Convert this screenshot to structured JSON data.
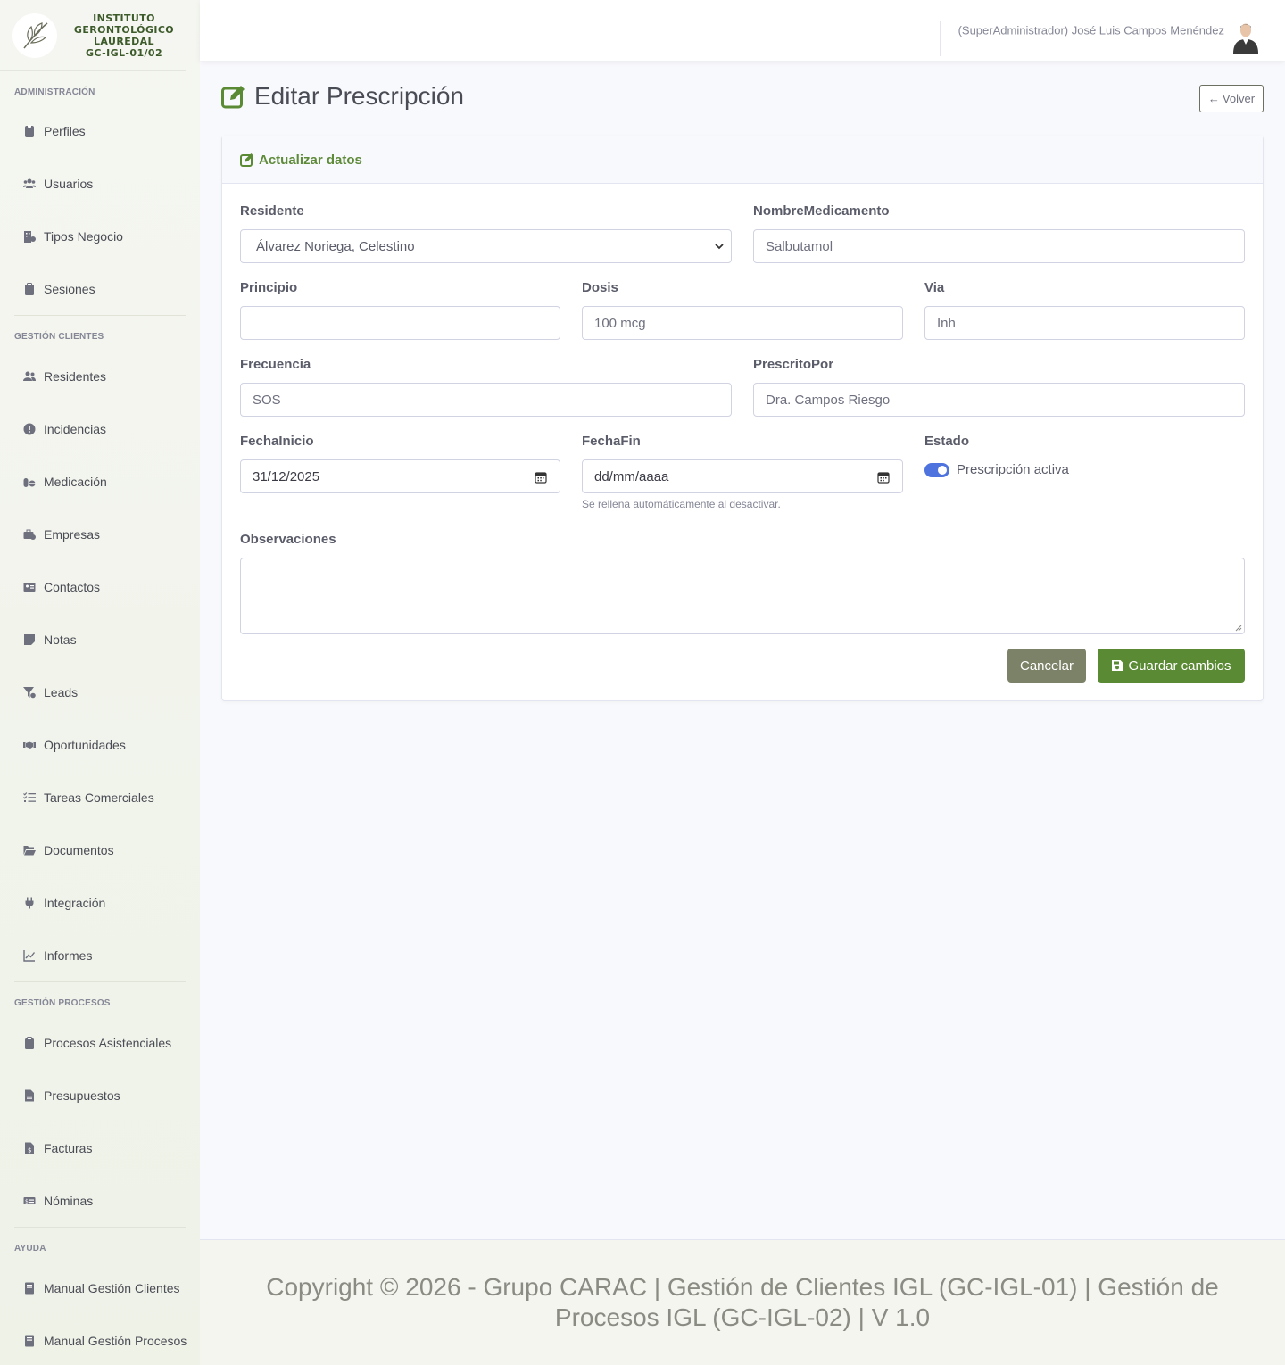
{
  "brand": {
    "line1": "INSTITUTO",
    "line2": "GERONTOLÓGICO",
    "line3": "LAUREDAL",
    "code": "GC-IGL-01/02"
  },
  "sidebar": {
    "sections": [
      {
        "heading": "ADMINISTRACIÓN",
        "items": [
          {
            "label": "Perfiles",
            "icon": "id-badge-icon"
          },
          {
            "label": "Usuarios",
            "icon": "users-icon"
          },
          {
            "label": "Tipos Negocio",
            "icon": "building-icon"
          },
          {
            "label": "Sesiones",
            "icon": "clipboard-icon"
          }
        ]
      },
      {
        "heading": "GESTIÓN CLIENTES",
        "items": [
          {
            "label": "Residentes",
            "icon": "user-friends-icon"
          },
          {
            "label": "Incidencias",
            "icon": "exclamation-circle-icon"
          },
          {
            "label": "Medicación",
            "icon": "pills-icon"
          },
          {
            "label": "Empresas",
            "icon": "briefcase-icon"
          },
          {
            "label": "Contactos",
            "icon": "address-card-icon"
          },
          {
            "label": "Notas",
            "icon": "sticky-note-icon"
          },
          {
            "label": "Leads",
            "icon": "funnel-icon"
          },
          {
            "label": "Oportunidades",
            "icon": "handshake-icon"
          },
          {
            "label": "Tareas Comerciales",
            "icon": "tasks-icon"
          },
          {
            "label": "Documentos",
            "icon": "folder-open-icon"
          },
          {
            "label": "Integración",
            "icon": "plug-icon"
          },
          {
            "label": "Informes",
            "icon": "chart-line-icon"
          }
        ]
      },
      {
        "heading": "GESTIÓN PROCESOS",
        "items": [
          {
            "label": "Procesos Asistenciales",
            "icon": "clipboard-icon"
          },
          {
            "label": "Presupuestos",
            "icon": "file-icon"
          },
          {
            "label": "Facturas",
            "icon": "invoice-icon"
          },
          {
            "label": "Nóminas",
            "icon": "money-check-icon"
          }
        ]
      },
      {
        "heading": "AYUDA",
        "items": [
          {
            "label": "Manual Gestión Clientes",
            "icon": "book-icon"
          },
          {
            "label": "Manual Gestión Procesos",
            "icon": "book-icon"
          }
        ]
      }
    ]
  },
  "topbar": {
    "user": "(SuperAdministrador) José Luis Campos Menéndez"
  },
  "page": {
    "title": "Editar Prescripción",
    "back_label": "Volver"
  },
  "card": {
    "title": "Actualizar datos"
  },
  "form": {
    "residente": {
      "label": "Residente",
      "value": "Álvarez Noriega, Celestino"
    },
    "nombre_medicamento": {
      "label": "NombreMedicamento",
      "value": "Salbutamol"
    },
    "principio": {
      "label": "Principio",
      "value": ""
    },
    "dosis": {
      "label": "Dosis",
      "value": "100 mcg"
    },
    "via": {
      "label": "Via",
      "value": "Inh"
    },
    "frecuencia": {
      "label": "Frecuencia",
      "value": "SOS"
    },
    "prescrito_por": {
      "label": "PrescritoPor",
      "value": "Dra. Campos Riesgo"
    },
    "fecha_inicio": {
      "label": "FechaInicio",
      "value": "31/12/2025"
    },
    "fecha_fin": {
      "label": "FechaFin",
      "value": "dd/mm/aaaa",
      "hint": "Se rellena automáticamente al desactivar."
    },
    "estado": {
      "label": "Estado",
      "switch_label": "Prescripción activa",
      "checked": true
    },
    "observaciones": {
      "label": "Observaciones",
      "value": ""
    },
    "cancel_label": "Cancelar",
    "save_label": "Guardar cambios"
  },
  "footer": {
    "text": "Copyright © 2026 - Grupo CARAC | Gestión de Clientes IGL (GC-IGL-01) | Gestión de Procesos IGL (GC-IGL-02) | V 1.0"
  },
  "colors": {
    "accent": "#5b8a35",
    "switch": "#4e73df",
    "cancel": "#7c8268"
  }
}
